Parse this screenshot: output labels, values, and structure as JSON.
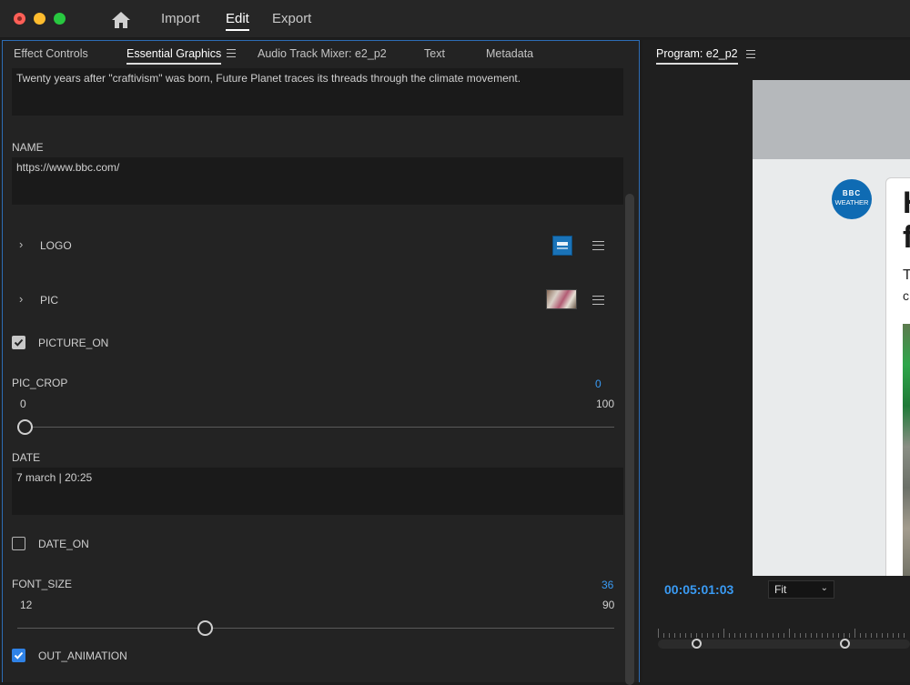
{
  "menu": {
    "import": "Import",
    "edit": "Edit",
    "export": "Export"
  },
  "left_tabs": [
    {
      "label": "Effect Controls"
    },
    {
      "label": "Essential Graphics"
    },
    {
      "label": "Audio Track Mixer: e2_p2"
    },
    {
      "label": "Text"
    },
    {
      "label": "Metadata"
    }
  ],
  "fields": {
    "description_value": "Twenty years after \"craftivism\" was born, Future Planet traces its threads through the climate movement.",
    "name_label": "NAME",
    "name_value": "https://www.bbc.com/",
    "logo_label": "LOGO",
    "pic_label": "PIC",
    "picture_on_label": "PICTURE_ON",
    "picture_on_checked": true,
    "pic_crop_label": "PIC_CROP",
    "pic_crop_value": "0",
    "pic_crop_min": "0",
    "pic_crop_max": "100",
    "date_label": "DATE",
    "date_value": "7 march | 20:25",
    "date_on_label": "DATE_ON",
    "date_on_checked": false,
    "font_size_label": "FONT_SIZE",
    "font_size_value": "36",
    "font_size_min": "12",
    "font_size_max": "90",
    "out_animation_label": "OUT_ANIMATION",
    "out_animation_checked": true
  },
  "program": {
    "tab_label": "Program: e2_p2",
    "timecode": "00:05:01:03",
    "zoom_select": "Fit",
    "preview": {
      "logo_line1": "BBC",
      "logo_line2": "WEATHER",
      "headline1": "H",
      "headline2": "f",
      "text1": "T",
      "text2": "c"
    }
  },
  "colors": {
    "accent": "#3a9bf4",
    "panel_border": "#2d6db5",
    "checkbox_on": "#2f82e6"
  }
}
